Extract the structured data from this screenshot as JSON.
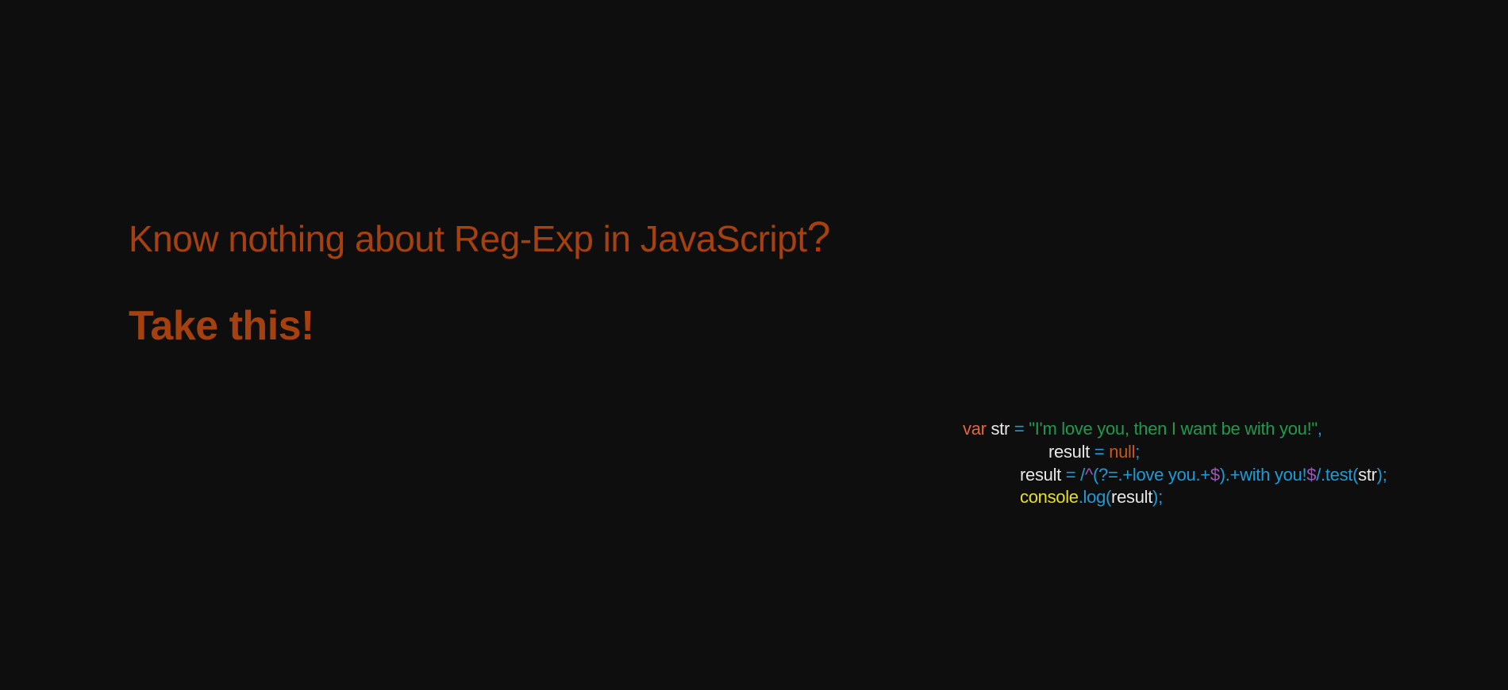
{
  "headline": {
    "text": "Know nothing about Reg-Exp in JavaScript",
    "mark": "?"
  },
  "subheadline": "Take this!",
  "code": {
    "colors": {
      "keyword": "#e8643a",
      "identifier": "#e8e8e8",
      "operator": "#1e9bd7",
      "string": "#1f9a4e",
      "null": "#c8571a",
      "regex": "#1e9bd7",
      "regex_meta": "#9b59b6",
      "console": "#e7e01c"
    },
    "lines": [
      {
        "tokens": [
          {
            "text": "var",
            "color": "#e8643a"
          },
          {
            "text": " ",
            "color": "#e8e8e8"
          },
          {
            "text": "str",
            "color": "#e8e8e8"
          },
          {
            "text": " = ",
            "color": "#1e9bd7"
          },
          {
            "text": "\"I'm love you, then I want be with you!\"",
            "color": "#1f9a4e"
          },
          {
            "text": ",",
            "color": "#1e9bd7"
          }
        ]
      },
      {
        "tokens": [
          {
            "text": "result",
            "color": "#e8e8e8"
          },
          {
            "text": " = ",
            "color": "#1e9bd7"
          },
          {
            "text": "null",
            "color": "#c8571a"
          },
          {
            "text": ";",
            "color": "#1e9bd7"
          }
        ]
      },
      {
        "tokens": [
          {
            "text": "result",
            "color": "#e8e8e8"
          },
          {
            "text": " = /",
            "color": "#1e9bd7"
          },
          {
            "text": "^",
            "color": "#9b59b6"
          },
          {
            "text": "(?=.+love you.+",
            "color": "#1e9bd7"
          },
          {
            "text": "$",
            "color": "#9b59b6"
          },
          {
            "text": ").+with you!",
            "color": "#1e9bd7"
          },
          {
            "text": "$",
            "color": "#9b59b6"
          },
          {
            "text": "/.test(",
            "color": "#1e9bd7"
          },
          {
            "text": "str",
            "color": "#e8e8e8"
          },
          {
            "text": ");",
            "color": "#1e9bd7"
          }
        ]
      },
      {
        "tokens": [
          {
            "text": "console",
            "color": "#e7e01c"
          },
          {
            "text": ".log(",
            "color": "#1e9bd7"
          },
          {
            "text": "result",
            "color": "#e8e8e8"
          },
          {
            "text": ");",
            "color": "#1e9bd7"
          }
        ]
      }
    ]
  }
}
